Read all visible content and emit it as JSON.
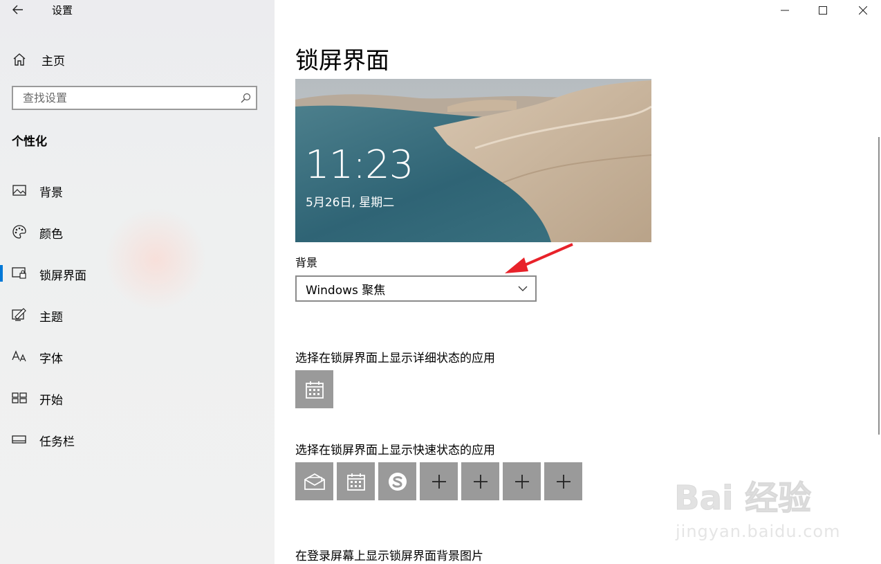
{
  "window": {
    "title": "设置"
  },
  "sidebar": {
    "home_label": "主页",
    "search_placeholder": "查找设置",
    "section_title": "个性化",
    "items": [
      {
        "label": "背景",
        "icon": "picture-icon"
      },
      {
        "label": "颜色",
        "icon": "palette-icon"
      },
      {
        "label": "锁屏界面",
        "icon": "lock-screen-icon",
        "active": true
      },
      {
        "label": "主题",
        "icon": "theme-icon"
      },
      {
        "label": "字体",
        "icon": "font-icon"
      },
      {
        "label": "开始",
        "icon": "start-icon"
      },
      {
        "label": "任务栏",
        "icon": "taskbar-icon"
      }
    ]
  },
  "main": {
    "title": "锁屏界面",
    "preview": {
      "time": "11:23",
      "date": "5月26日, 星期二"
    },
    "background_label": "背景",
    "background_value": "Windows 聚焦",
    "detailed_status_heading": "选择在锁屏界面上显示详细状态的应用",
    "detailed_status_apps": [
      "calendar-icon"
    ],
    "quick_status_heading": "选择在锁屏界面上显示快速状态的应用",
    "quick_status_apps": [
      "mail-icon",
      "calendar-icon",
      "skype-icon",
      "plus-icon",
      "plus-icon",
      "plus-icon",
      "plus-icon"
    ],
    "signin_heading": "在登录屏幕上显示锁屏界面背景图片"
  },
  "watermark": {
    "brand": "Bai 经验",
    "url": "jingyan.baidu.com"
  },
  "colors": {
    "accent": "#0078d7",
    "tile": "#9a9a9a",
    "arrow": "#e8222a"
  }
}
